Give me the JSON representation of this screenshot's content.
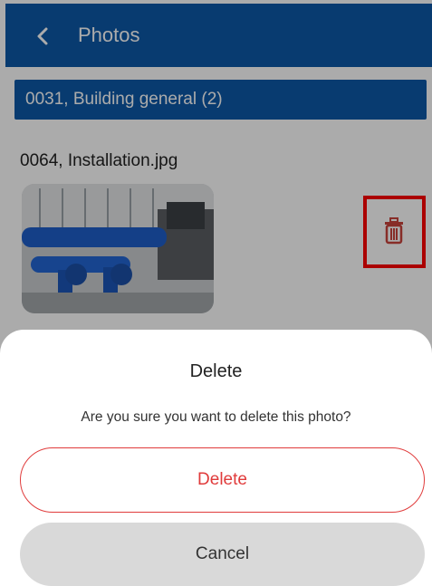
{
  "header": {
    "title": "Photos",
    "back_icon": "chevron-left-icon",
    "color": "#0d59a7"
  },
  "section": {
    "label": "0031, Building general (2)"
  },
  "photo": {
    "file_name": "0064, Installation.jpg",
    "delete_icon": "trash-icon",
    "highlight_color": "#ff0000"
  },
  "dialog": {
    "title": "Delete",
    "message": "Are you sure you want to delete this photo?",
    "delete_label": "Delete",
    "cancel_label": "Cancel",
    "delete_color": "#e03b3b"
  }
}
